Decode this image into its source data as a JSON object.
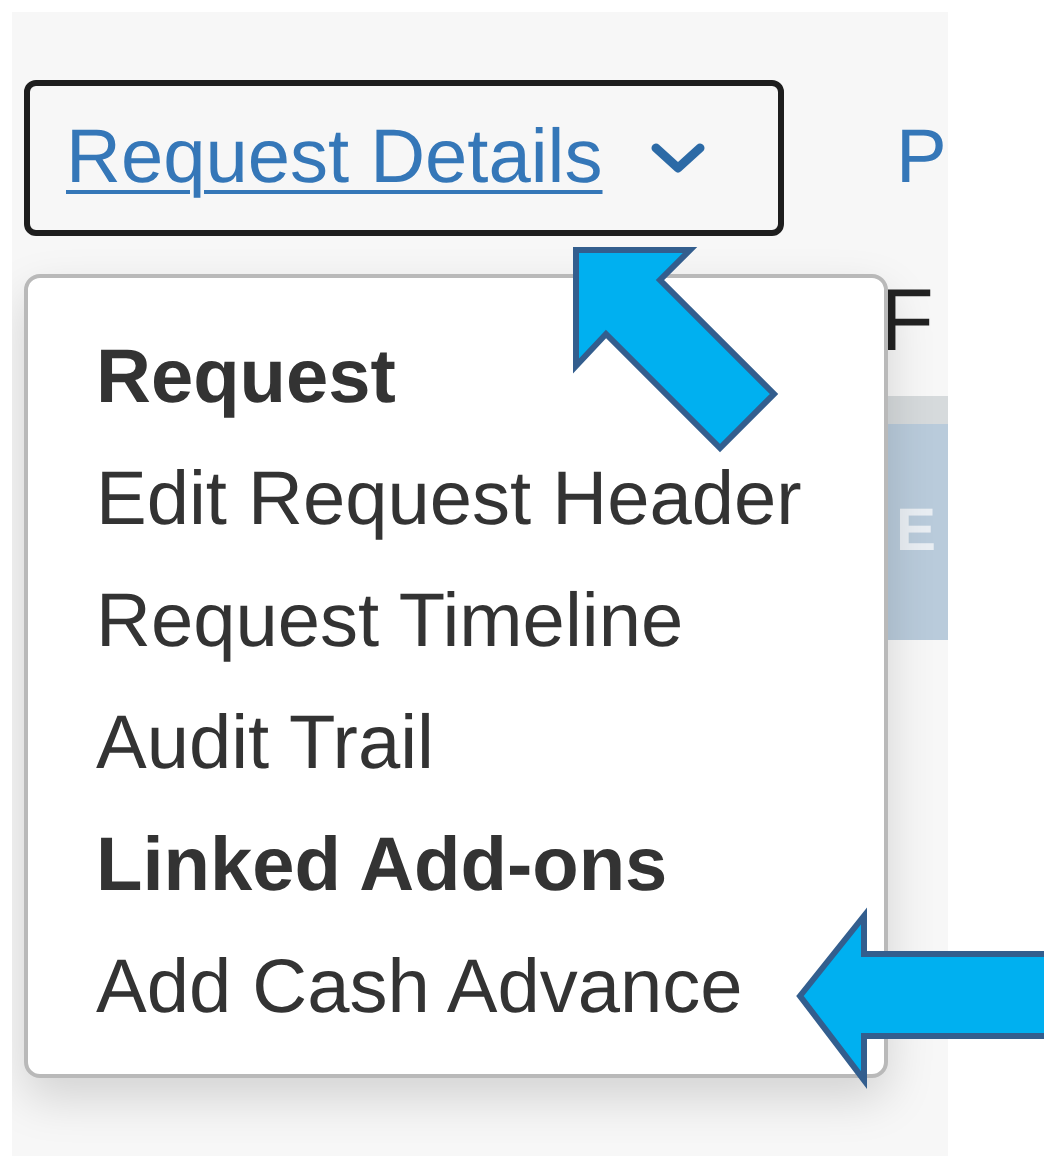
{
  "dropdown_button": {
    "label": "Request Details",
    "expanded": true
  },
  "next_tab": {
    "label": "P"
  },
  "page_heading": "F",
  "action_bar": {
    "label": "E"
  },
  "menu": {
    "sections": [
      {
        "heading": "Request",
        "items": [
          "Edit Request Header",
          "Request Timeline",
          "Audit Trail"
        ]
      },
      {
        "heading": "Linked Add-ons",
        "items": [
          "Add Cash Advance"
        ]
      }
    ]
  },
  "callouts": [
    {
      "kind": "up-left"
    },
    {
      "kind": "left"
    }
  ]
}
